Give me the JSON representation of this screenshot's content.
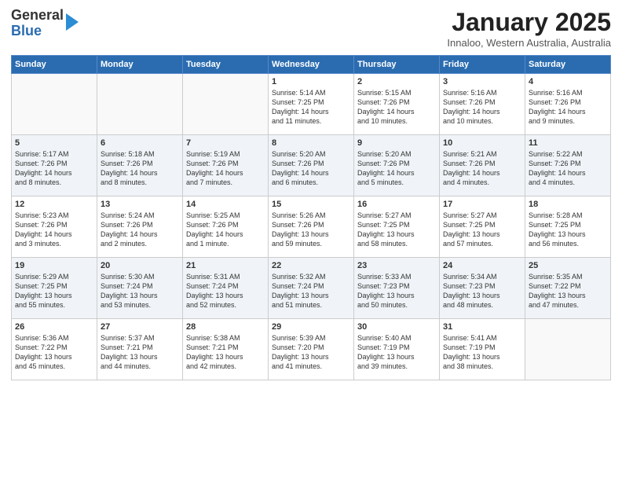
{
  "header": {
    "logo_line1": "General",
    "logo_line2": "Blue",
    "month_title": "January 2025",
    "subtitle": "Innaloo, Western Australia, Australia"
  },
  "days_of_week": [
    "Sunday",
    "Monday",
    "Tuesday",
    "Wednesday",
    "Thursday",
    "Friday",
    "Saturday"
  ],
  "weeks": [
    [
      {
        "day": "",
        "content": ""
      },
      {
        "day": "",
        "content": ""
      },
      {
        "day": "",
        "content": ""
      },
      {
        "day": "1",
        "content": "Sunrise: 5:14 AM\nSunset: 7:25 PM\nDaylight: 14 hours\nand 11 minutes."
      },
      {
        "day": "2",
        "content": "Sunrise: 5:15 AM\nSunset: 7:26 PM\nDaylight: 14 hours\nand 10 minutes."
      },
      {
        "day": "3",
        "content": "Sunrise: 5:16 AM\nSunset: 7:26 PM\nDaylight: 14 hours\nand 10 minutes."
      },
      {
        "day": "4",
        "content": "Sunrise: 5:16 AM\nSunset: 7:26 PM\nDaylight: 14 hours\nand 9 minutes."
      }
    ],
    [
      {
        "day": "5",
        "content": "Sunrise: 5:17 AM\nSunset: 7:26 PM\nDaylight: 14 hours\nand 8 minutes."
      },
      {
        "day": "6",
        "content": "Sunrise: 5:18 AM\nSunset: 7:26 PM\nDaylight: 14 hours\nand 8 minutes."
      },
      {
        "day": "7",
        "content": "Sunrise: 5:19 AM\nSunset: 7:26 PM\nDaylight: 14 hours\nand 7 minutes."
      },
      {
        "day": "8",
        "content": "Sunrise: 5:20 AM\nSunset: 7:26 PM\nDaylight: 14 hours\nand 6 minutes."
      },
      {
        "day": "9",
        "content": "Sunrise: 5:20 AM\nSunset: 7:26 PM\nDaylight: 14 hours\nand 5 minutes."
      },
      {
        "day": "10",
        "content": "Sunrise: 5:21 AM\nSunset: 7:26 PM\nDaylight: 14 hours\nand 4 minutes."
      },
      {
        "day": "11",
        "content": "Sunrise: 5:22 AM\nSunset: 7:26 PM\nDaylight: 14 hours\nand 4 minutes."
      }
    ],
    [
      {
        "day": "12",
        "content": "Sunrise: 5:23 AM\nSunset: 7:26 PM\nDaylight: 14 hours\nand 3 minutes."
      },
      {
        "day": "13",
        "content": "Sunrise: 5:24 AM\nSunset: 7:26 PM\nDaylight: 14 hours\nand 2 minutes."
      },
      {
        "day": "14",
        "content": "Sunrise: 5:25 AM\nSunset: 7:26 PM\nDaylight: 14 hours\nand 1 minute."
      },
      {
        "day": "15",
        "content": "Sunrise: 5:26 AM\nSunset: 7:26 PM\nDaylight: 13 hours\nand 59 minutes."
      },
      {
        "day": "16",
        "content": "Sunrise: 5:27 AM\nSunset: 7:25 PM\nDaylight: 13 hours\nand 58 minutes."
      },
      {
        "day": "17",
        "content": "Sunrise: 5:27 AM\nSunset: 7:25 PM\nDaylight: 13 hours\nand 57 minutes."
      },
      {
        "day": "18",
        "content": "Sunrise: 5:28 AM\nSunset: 7:25 PM\nDaylight: 13 hours\nand 56 minutes."
      }
    ],
    [
      {
        "day": "19",
        "content": "Sunrise: 5:29 AM\nSunset: 7:25 PM\nDaylight: 13 hours\nand 55 minutes."
      },
      {
        "day": "20",
        "content": "Sunrise: 5:30 AM\nSunset: 7:24 PM\nDaylight: 13 hours\nand 53 minutes."
      },
      {
        "day": "21",
        "content": "Sunrise: 5:31 AM\nSunset: 7:24 PM\nDaylight: 13 hours\nand 52 minutes."
      },
      {
        "day": "22",
        "content": "Sunrise: 5:32 AM\nSunset: 7:24 PM\nDaylight: 13 hours\nand 51 minutes."
      },
      {
        "day": "23",
        "content": "Sunrise: 5:33 AM\nSunset: 7:23 PM\nDaylight: 13 hours\nand 50 minutes."
      },
      {
        "day": "24",
        "content": "Sunrise: 5:34 AM\nSunset: 7:23 PM\nDaylight: 13 hours\nand 48 minutes."
      },
      {
        "day": "25",
        "content": "Sunrise: 5:35 AM\nSunset: 7:22 PM\nDaylight: 13 hours\nand 47 minutes."
      }
    ],
    [
      {
        "day": "26",
        "content": "Sunrise: 5:36 AM\nSunset: 7:22 PM\nDaylight: 13 hours\nand 45 minutes."
      },
      {
        "day": "27",
        "content": "Sunrise: 5:37 AM\nSunset: 7:21 PM\nDaylight: 13 hours\nand 44 minutes."
      },
      {
        "day": "28",
        "content": "Sunrise: 5:38 AM\nSunset: 7:21 PM\nDaylight: 13 hours\nand 42 minutes."
      },
      {
        "day": "29",
        "content": "Sunrise: 5:39 AM\nSunset: 7:20 PM\nDaylight: 13 hours\nand 41 minutes."
      },
      {
        "day": "30",
        "content": "Sunrise: 5:40 AM\nSunset: 7:19 PM\nDaylight: 13 hours\nand 39 minutes."
      },
      {
        "day": "31",
        "content": "Sunrise: 5:41 AM\nSunset: 7:19 PM\nDaylight: 13 hours\nand 38 minutes."
      },
      {
        "day": "",
        "content": ""
      }
    ]
  ]
}
